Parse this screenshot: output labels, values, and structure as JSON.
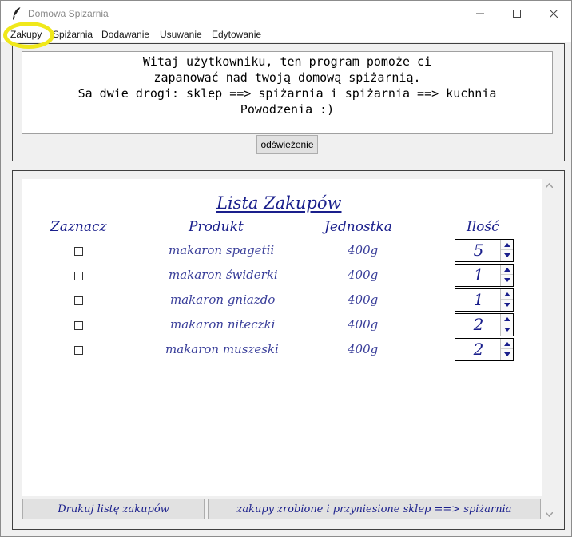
{
  "window": {
    "title": "Domowa Spizarnia",
    "icons": {
      "app": "feather-icon",
      "minimize": "minimize-icon",
      "maximize": "maximize-icon",
      "close": "close-icon"
    }
  },
  "menu": [
    "Zakupy",
    "Spiżarnia",
    "Dodawanie",
    "Usuwanie",
    "Edytowanie"
  ],
  "welcome": {
    "lines": [
      "Witaj użytkowniku, ten program pomoże ci",
      "zapanować nad twoją domową spiżarnią.",
      "Sa dwie drogi: sklep ==> spiżarnia i spiżarnia ==> kuchnia",
      "Powodzenia :)"
    ]
  },
  "refresh_label": "odświeżenie",
  "shopping": {
    "title": "Lista Zakupów",
    "headers": [
      "Zaznacz",
      "Produkt",
      "Jednostka",
      "Ilość"
    ],
    "rows": [
      {
        "product": "makaron spagetii",
        "unit": "400g",
        "qty": "5",
        "checked": false
      },
      {
        "product": "makaron świderki",
        "unit": "400g",
        "qty": "1",
        "checked": false
      },
      {
        "product": "makaron gniazdo",
        "unit": "400g",
        "qty": "1",
        "checked": false
      },
      {
        "product": "makaron niteczki",
        "unit": "400g",
        "qty": "2",
        "checked": false
      },
      {
        "product": "makaron muszeski",
        "unit": "400g",
        "qty": "2",
        "checked": false
      }
    ]
  },
  "buttons": {
    "print": "Drukuj listę zakupów",
    "done": "zakupy zrobione i przyniesione sklep ==> spiżarnia"
  },
  "colors": {
    "highlight": "#f0e81a",
    "handwriting": "#1a1f8c",
    "spin_arrow": "#1a1f8c"
  }
}
